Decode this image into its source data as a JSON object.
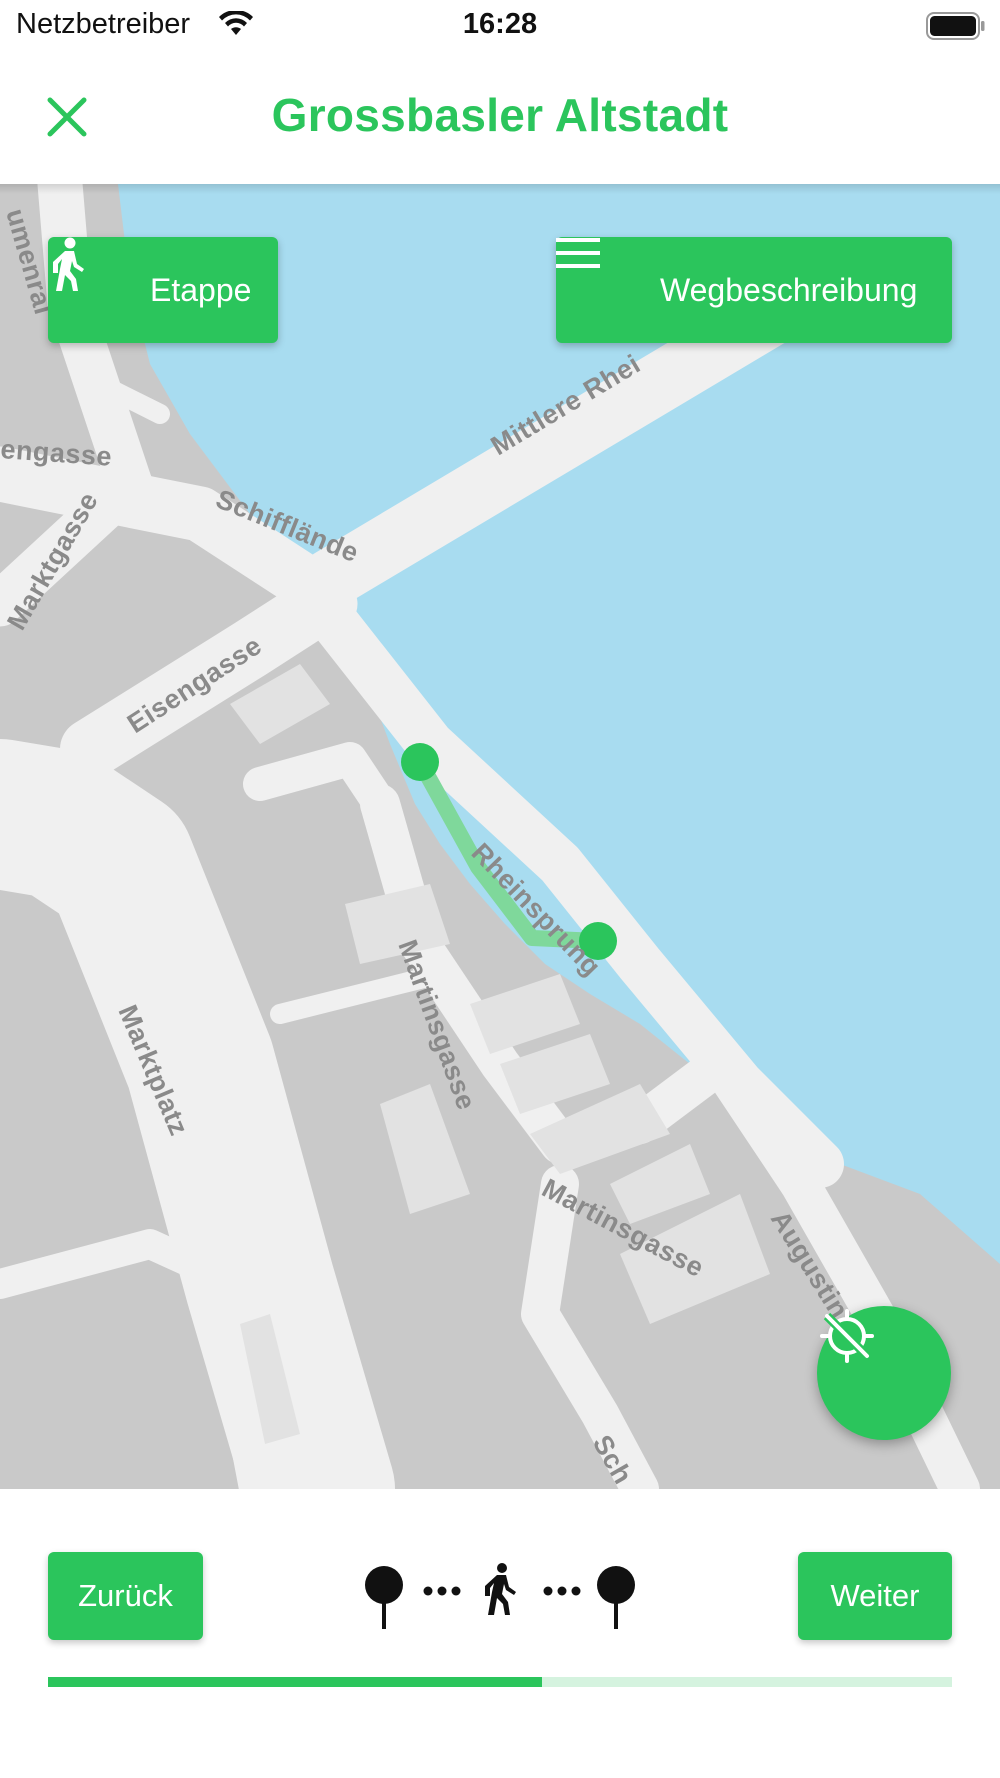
{
  "status_bar": {
    "carrier": "Netzbetreiber",
    "time": "16:28"
  },
  "header": {
    "title": "Grossbasler Altstadt",
    "close_icon": "close-icon"
  },
  "map": {
    "etappe_button": {
      "label": "Etappe",
      "icon": "walking-person-icon"
    },
    "directions_button": {
      "label": "Wegbeschreibung",
      "icon": "menu-icon"
    },
    "location_button": {
      "icon": "location-off-icon"
    },
    "street_labels": {
      "mittlere_rheinbruecke": "Mittlere Rhei",
      "schifflaende": "Schifflände",
      "eisengasse": "Eisengasse",
      "marktgasse": "Marktgasse",
      "engasse": "engasse",
      "blumenrain": "umenrai",
      "rheinsprung": "Rheinsprung",
      "martinsgasse_1": "Martinsgasse",
      "martinsgasse_2": "Martinsgasse",
      "marktplatz": "Marktplatz",
      "augustinergasse": "Augustin",
      "schluesselberg": "Sch"
    }
  },
  "bottom_bar": {
    "back_label": "Zurück",
    "next_label": "Weiter",
    "progress_fraction": 0.546
  },
  "colors": {
    "accent": "#2bc55c",
    "water": "#a8dcf0",
    "buildings": "#c9c9c9",
    "streets": "#f0f0f0"
  }
}
